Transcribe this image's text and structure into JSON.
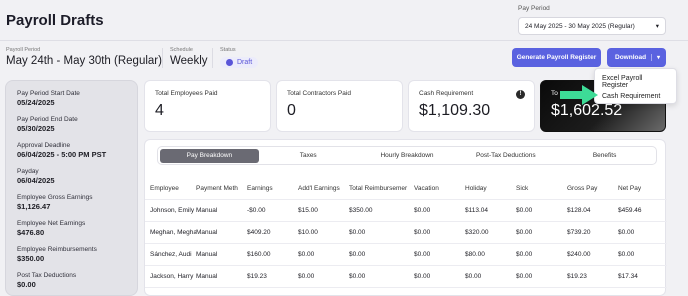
{
  "page": {
    "title": "Payroll Drafts"
  },
  "pay_period_picker": {
    "label": "Pay Period",
    "value": "24 May 2025 - 30 May 2025 (Regular)"
  },
  "meta": {
    "pay_period_label": "Payroll Period",
    "pay_period_value": "May 24th - May 30th (Regular)",
    "schedule_label": "Schedule",
    "schedule_value": "Weekly",
    "status_label": "Status",
    "status_value": "Draft"
  },
  "actions": {
    "generate_label": "Generate Payroll Register",
    "download_label": "Download",
    "download_menu": [
      "Excel Payroll Register",
      "Cash Requirement"
    ]
  },
  "sidebar": [
    {
      "label": "Pay Period Start Date",
      "value": "05/24/2025"
    },
    {
      "label": "Pay Period End Date",
      "value": "05/30/2025"
    },
    {
      "label": "Approval Deadline",
      "value": "06/04/2025 - 5:00 PM PST"
    },
    {
      "label": "Payday",
      "value": "06/04/2025"
    },
    {
      "label": "Employee Gross Earnings",
      "value": "$1,126.47"
    },
    {
      "label": "Employee Net Earnings",
      "value": "$476.80"
    },
    {
      "label": "Employee Reimbursements",
      "value": "$350.00"
    },
    {
      "label": "Post Tax Deductions",
      "value": "$0.00"
    }
  ],
  "cards": [
    {
      "label": "Total Employees Paid",
      "value": "4"
    },
    {
      "label": "Total Contractors Paid",
      "value": "0"
    },
    {
      "label": "Cash Requirement",
      "value": "$1,109.30"
    },
    {
      "label": "To",
      "value": "$1,602.52"
    }
  ],
  "tabs": [
    "Pay Breakdown",
    "Taxes",
    "Hourly Breakdown",
    "Post-Tax Deductions",
    "Benefits"
  ],
  "table": {
    "headers": [
      "Employee",
      "Payment Meth",
      "Earnings",
      "Add'l Earnings",
      "Total Reimbursemer",
      "Vacation",
      "Holiday",
      "Sick",
      "Gross Pay",
      "Net Pay"
    ],
    "rows": [
      [
        "Johnson, Emily",
        "Manual",
        "-$0.00",
        "$15.00",
        "$350.00",
        "$0.00",
        "$113.04",
        "$0.00",
        "$128.04",
        "$459.46"
      ],
      [
        "Meghan, Megha",
        "Manual",
        "$409.20",
        "$10.00",
        "$0.00",
        "$0.00",
        "$320.00",
        "$0.00",
        "$739.20",
        "$0.00"
      ],
      [
        "Sánchez, Audi",
        "Manual",
        "$160.00",
        "$0.00",
        "$0.00",
        "$0.00",
        "$80.00",
        "$0.00",
        "$240.00",
        "$0.00"
      ],
      [
        "Jackson, Harry",
        "Manual",
        "$19.23",
        "$0.00",
        "$0.00",
        "$0.00",
        "$0.00",
        "$0.00",
        "$19.23",
        "$17.34"
      ]
    ]
  },
  "colors": {
    "accent": "#5a62e0",
    "arrow": "#3ddc97"
  }
}
